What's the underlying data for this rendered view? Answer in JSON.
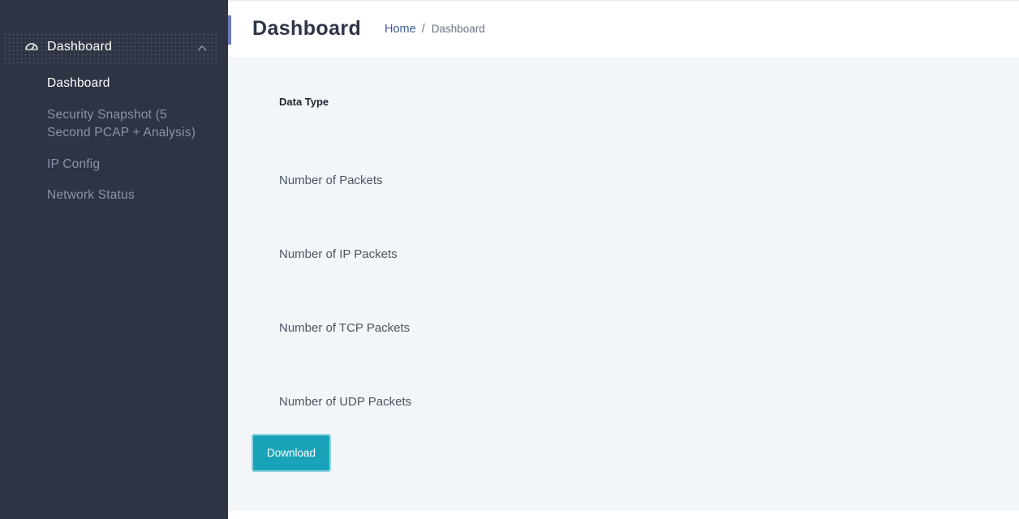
{
  "sidebar": {
    "parent": {
      "label": "Dashboard",
      "icon": "dashboard-gauge-icon",
      "expanded": true
    },
    "items": [
      {
        "label": "Dashboard",
        "active": true
      },
      {
        "label": "Security Snapshot (5 Second PCAP + Analysis)",
        "active": false
      },
      {
        "label": "IP Config",
        "active": false
      },
      {
        "label": "Network Status",
        "active": false
      }
    ]
  },
  "header": {
    "title": "Dashboard",
    "breadcrumb": {
      "home": "Home",
      "separator": "/",
      "current": "Dashboard"
    }
  },
  "main": {
    "column_header": "Data Type",
    "rows": [
      {
        "label": "Number of Packets"
      },
      {
        "label": "Number of IP Packets"
      },
      {
        "label": "Number of TCP Packets"
      },
      {
        "label": "Number of UDP Packets"
      }
    ],
    "download_label": "Download"
  },
  "colors": {
    "sidebar_bg": "#2e3443",
    "main_bg": "#f2f6f9",
    "accent": "#6a7bc0",
    "button": "#1aa3b8",
    "link": "#3d5a98"
  }
}
